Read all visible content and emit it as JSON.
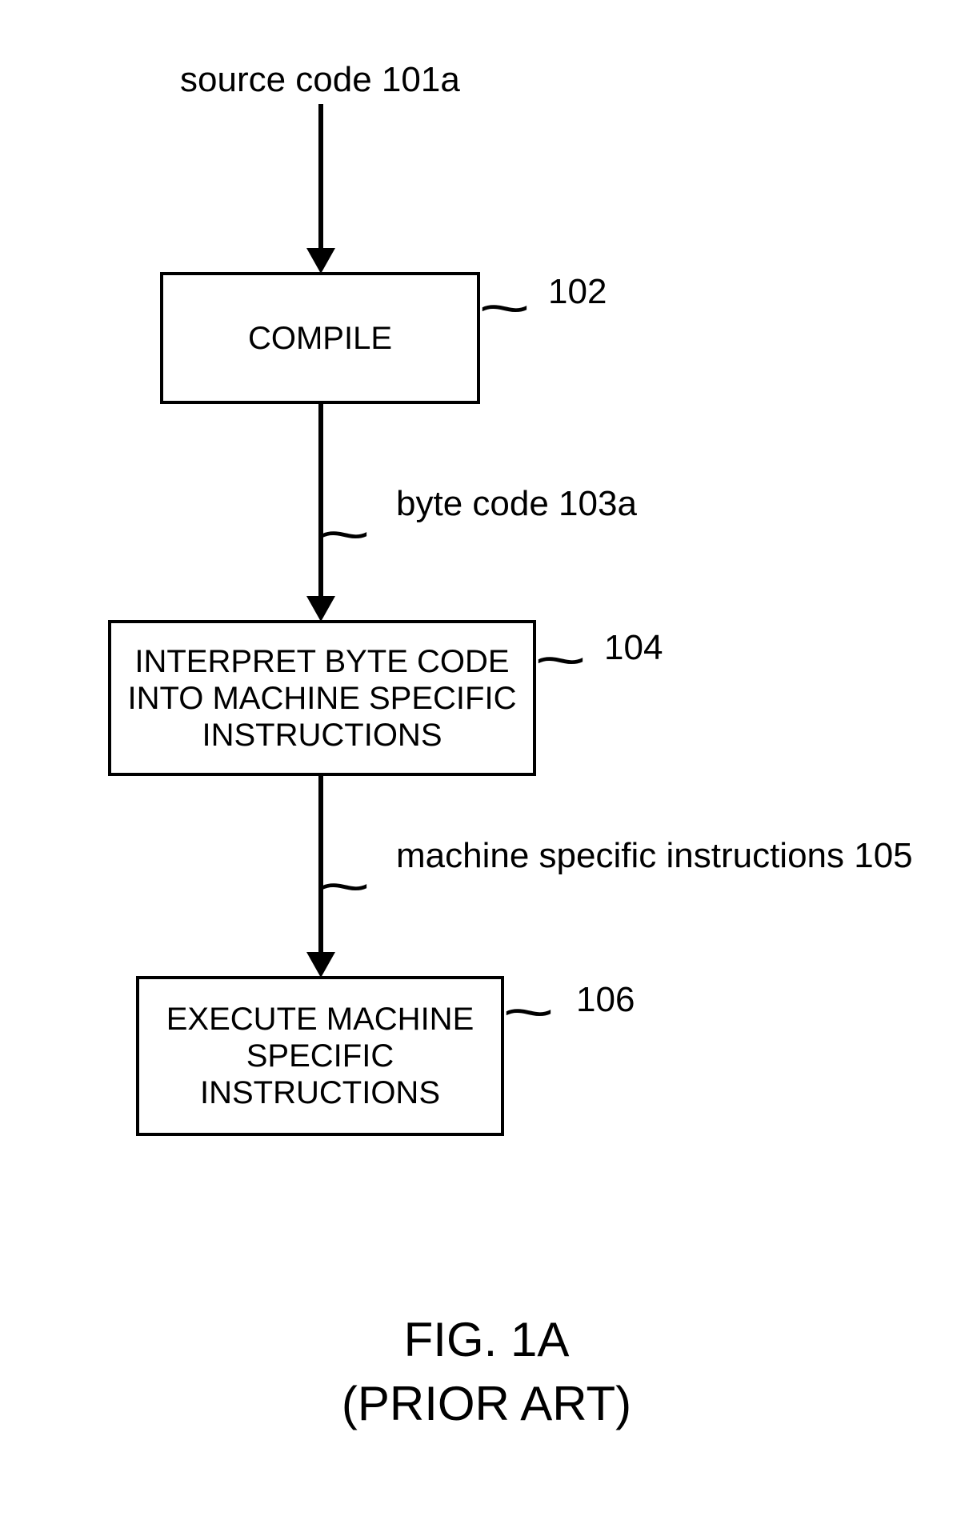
{
  "labels": {
    "source_code": "source code  101a",
    "byte_code": "byte code 103a",
    "machine_instr": "machine specific instructions 105",
    "ref_102": "102",
    "ref_104": "104",
    "ref_106": "106"
  },
  "boxes": {
    "compile": "COMPILE",
    "interpret": "INTERPRET BYTE CODE INTO MACHINE SPECIFIC INSTRUCTIONS",
    "execute": "EXECUTE MACHINE SPECIFIC INSTRUCTIONS"
  },
  "figure": {
    "title": "FIG. 1A",
    "subtitle": "(PRIOR ART)"
  }
}
